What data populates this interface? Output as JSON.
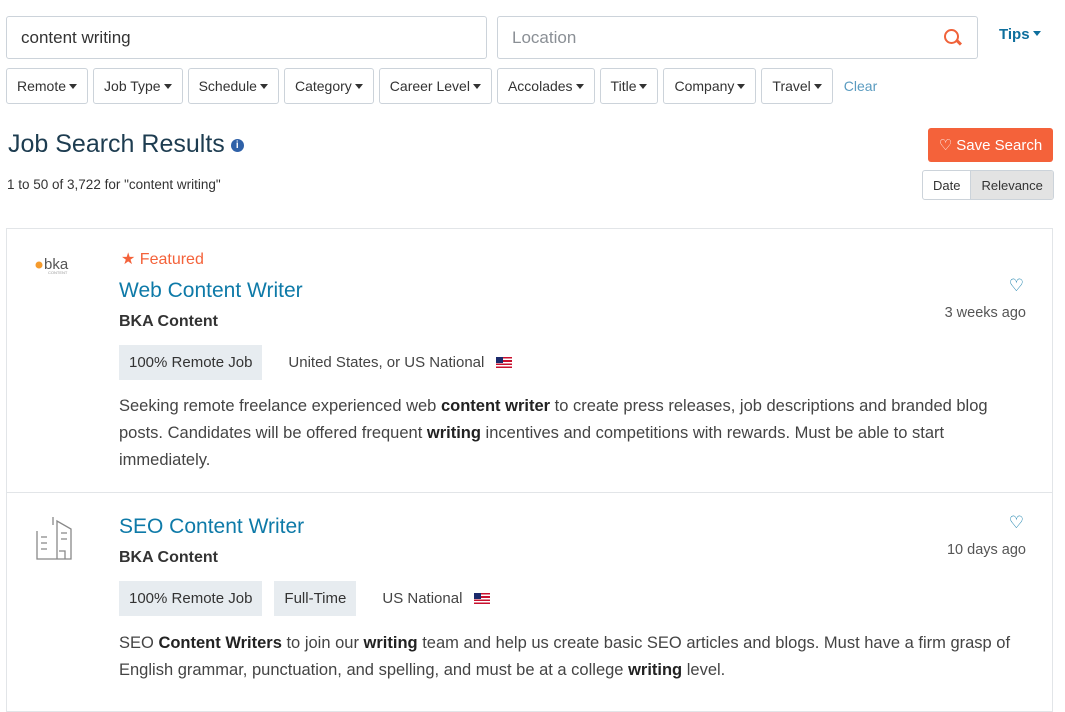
{
  "search": {
    "query": "content writing",
    "location_placeholder": "Location",
    "tips": "Tips"
  },
  "filters": [
    "Remote",
    "Job Type",
    "Schedule",
    "Category",
    "Career Level",
    "Accolades",
    "Title",
    "Company",
    "Travel"
  ],
  "clear": "Clear",
  "title": "Job Search Results",
  "save_search": "Save Search",
  "count": "1 to 50 of 3,722 for \"content writing\"",
  "sort": {
    "date": "Date",
    "relevance": "Relevance",
    "active": "Relevance"
  },
  "colors": {
    "accent": "#f4623a",
    "link": "#0e7aa8"
  },
  "jobs": [
    {
      "featured": "Featured",
      "title": "Web Content Writer",
      "company": "BKA Content",
      "logo": "bka",
      "tags": [
        "100% Remote Job"
      ],
      "location": "United States, or US National",
      "age": "3 weeks ago",
      "desc": [
        "Seeking remote freelance experienced web ",
        "content writer",
        " to create press releases, job descriptions and branded blog posts. Candidates will be offered frequent ",
        "writing",
        " incentives and competitions with rewards. Must be able to start immediately."
      ]
    },
    {
      "title": "SEO Content Writer",
      "company": "BKA Content",
      "tags": [
        "100% Remote Job",
        "Full-Time"
      ],
      "location": "US National",
      "age": "10 days ago",
      "desc": [
        "SEO ",
        "Content Writers",
        " to join our ",
        "writing",
        " team and help us create basic SEO articles and blogs. Must have a firm grasp of English grammar, punctuation, and spelling, and must be at a college ",
        "writing",
        " level."
      ]
    }
  ]
}
